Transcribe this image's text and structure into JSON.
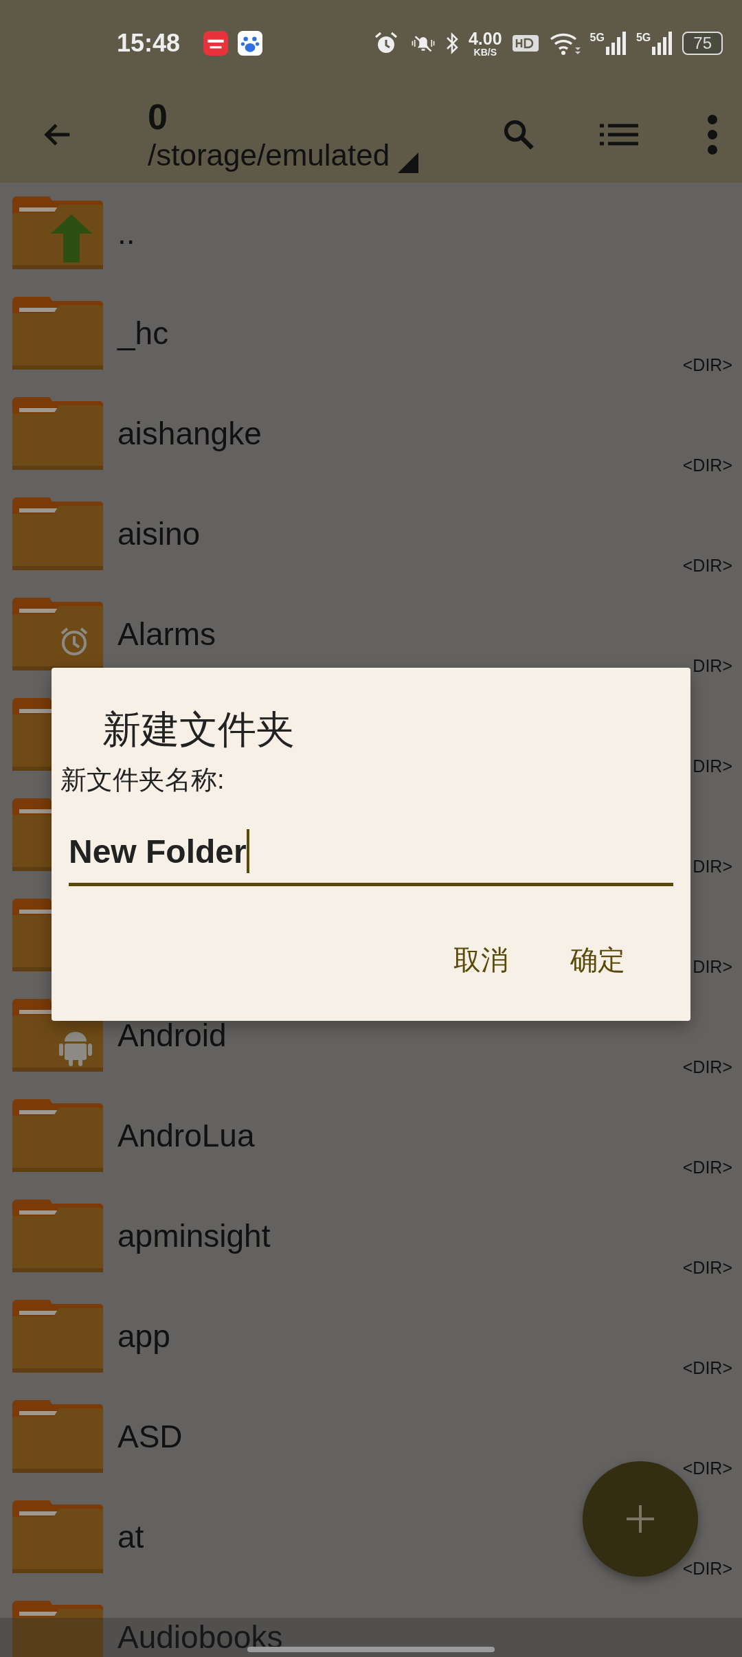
{
  "status_bar": {
    "time": "15:48",
    "apps": [
      {
        "kind": "redbook"
      },
      {
        "kind": "paw"
      }
    ],
    "speed": {
      "value": "4.00",
      "unit": "KB/S"
    },
    "signals": [
      {
        "label": "5G"
      },
      {
        "label": "5G"
      }
    ],
    "battery": "75"
  },
  "toolbar": {
    "title": "0",
    "path": "/storage/emulated"
  },
  "files": [
    {
      "name": "..",
      "kind": "up"
    },
    {
      "name": "_hc",
      "kind": "plain",
      "tag": "<DIR>"
    },
    {
      "name": "aishangke",
      "kind": "plain",
      "tag": "<DIR>"
    },
    {
      "name": "aisino",
      "kind": "plain",
      "tag": "<DIR>"
    },
    {
      "name": "Alarms",
      "kind": "alarm",
      "tag": "DIR>"
    },
    {
      "kind": "plain",
      "tag": "DIR>"
    },
    {
      "kind": "plain",
      "tag": "DIR>"
    },
    {
      "kind": "plain",
      "tag": "DIR>"
    },
    {
      "name": "Android",
      "kind": "android",
      "tag": "<DIR>"
    },
    {
      "name": "AndroLua",
      "kind": "plain",
      "tag": "<DIR>"
    },
    {
      "name": "apminsight",
      "kind": "plain",
      "tag": "<DIR>"
    },
    {
      "name": "app",
      "kind": "plain",
      "tag": "<DIR>"
    },
    {
      "name": "ASD",
      "kind": "plain",
      "tag": "<DIR>"
    },
    {
      "name": "at",
      "kind": "plain",
      "tag": "<DIR>"
    },
    {
      "name": "Audiobooks",
      "kind": "plain"
    }
  ],
  "dialog": {
    "title": "新建文件夹",
    "label": "新文件夹名称:",
    "value": "New Folder",
    "buttons": [
      "取消",
      "确定"
    ]
  }
}
